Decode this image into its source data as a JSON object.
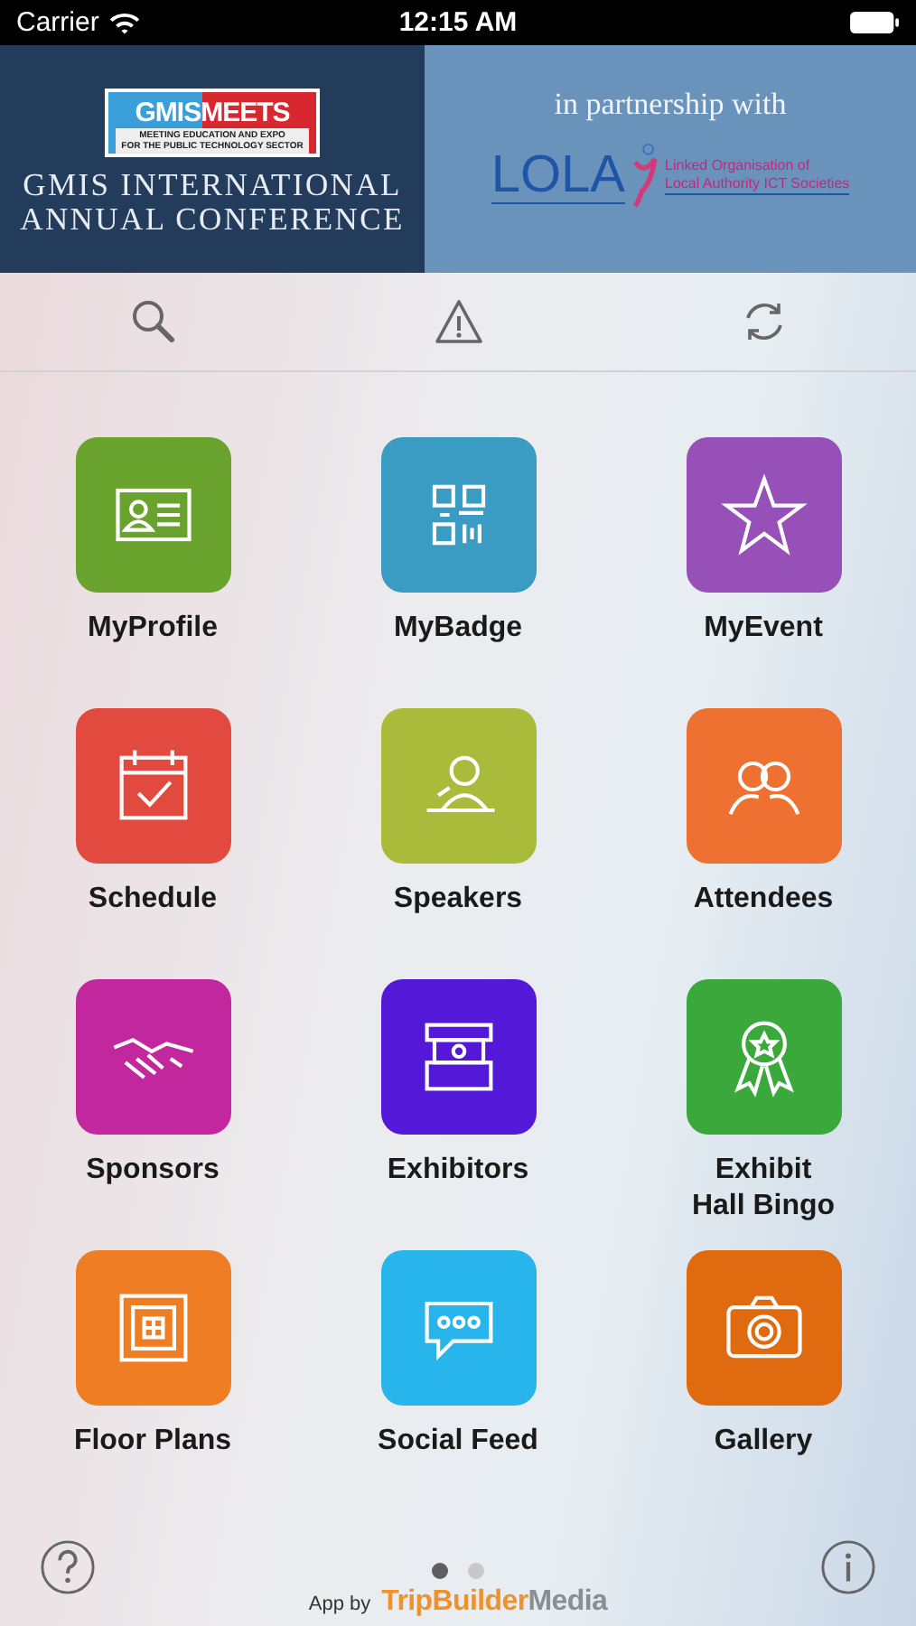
{
  "status_bar": {
    "carrier": "Carrier",
    "time": "12:15 AM"
  },
  "banner": {
    "logo_main": "GMISMEETS",
    "logo_tagline_1": "MEETING EDUCATION AND EXPO",
    "logo_tagline_2": "FOR THE PUBLIC TECHNOLOGY SECTOR",
    "title_lines": [
      "GMIS INTERNATIONAL",
      "ANNUAL CONFERENCE"
    ],
    "partnership": "in partnership with",
    "partner_name": "LOLA",
    "partner_full_1": "Linked Organisation of",
    "partner_full_2": "Local Authority ICT Societies"
  },
  "toolbar": [
    {
      "kind": "search"
    },
    {
      "kind": "alert"
    },
    {
      "kind": "sync"
    }
  ],
  "tiles": [
    {
      "label": "MyProfile",
      "color": "#6aa22e",
      "kind": "profile"
    },
    {
      "label": "MyBadge",
      "color": "#3a9bc3",
      "kind": "badge"
    },
    {
      "label": "MyEvent",
      "color": "#9650b8",
      "kind": "star"
    },
    {
      "label": "Schedule",
      "color": "#e24a3f",
      "kind": "calendar"
    },
    {
      "label": "Speakers",
      "color": "#a8bb3a",
      "kind": "speaker"
    },
    {
      "label": "Attendees",
      "color": "#ef7131",
      "kind": "attendees"
    },
    {
      "label": "Sponsors",
      "color": "#c2279e",
      "kind": "handshake"
    },
    {
      "label": "Exhibitors",
      "color": "#5418d8",
      "kind": "booth"
    },
    {
      "label": "Exhibit\nHall Bingo",
      "color": "#3aa83a",
      "kind": "ribbon"
    },
    {
      "label": "Floor Plans",
      "color": "#ef7d24",
      "kind": "floorplan"
    },
    {
      "label": "Social Feed",
      "color": "#27b5ec",
      "kind": "chat"
    },
    {
      "label": "Gallery",
      "color": "#e06a10",
      "kind": "camera"
    }
  ],
  "page_dots": [
    {
      "selected": true
    },
    {
      "selected": false
    }
  ],
  "footer": {
    "prefix": "App by",
    "brand": [
      {
        "text": "TripBuilder",
        "color": "#f0922b"
      },
      {
        "text": "Media",
        "color": "#8a8f96"
      }
    ]
  }
}
